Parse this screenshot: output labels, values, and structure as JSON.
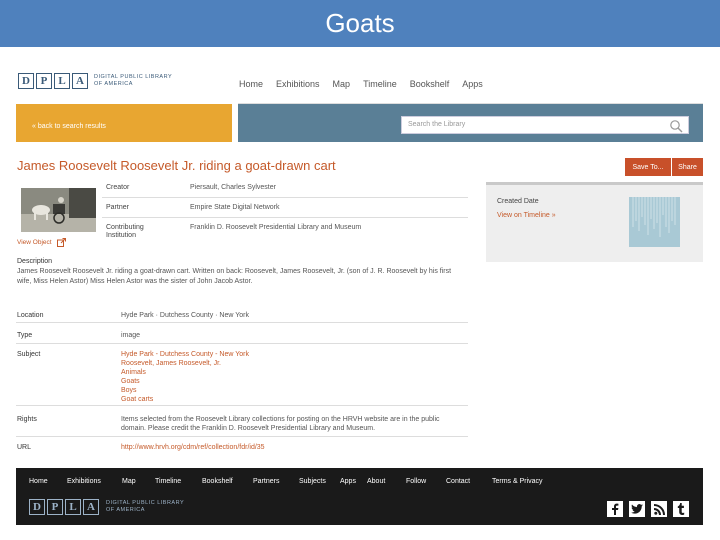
{
  "slide": {
    "title": "Goats"
  },
  "logo": {
    "letters": [
      "D",
      "P",
      "L",
      "A"
    ],
    "line1": "DIGITAL PUBLIC LIBRARY",
    "line2": "OF AMERICA"
  },
  "topnav": [
    "Home",
    "Exhibitions",
    "Map",
    "Timeline",
    "Bookshelf",
    "Apps"
  ],
  "banner": {
    "back_link": "« back to search results",
    "search_placeholder": "Search the Library"
  },
  "item": {
    "title": "James Roosevelt Roosevelt Jr. riding a goat-drawn cart",
    "save_label": "Save To...",
    "share_label": "Share",
    "view_object": "View Object",
    "metadata": [
      {
        "label": "Creator",
        "value": "Piersault, Charles Sylvester"
      },
      {
        "label": "Partner",
        "value": "Empire State Digital Network"
      },
      {
        "label": "Contributing Institution",
        "value": "Franklin D. Roosevelt Presidential Library and Museum"
      }
    ],
    "description_label": "Description",
    "description": "James Roosevelt Roosevelt Jr. riding a goat-drawn cart. Written on back: Roosevelt, James Roosevelt, Jr. (son of J. R. Roosevelt by his first wife, Miss Helen Astor) Miss Helen Astor was the sister of John Jacob Astor.",
    "details": [
      {
        "label": "Location",
        "values": [
          "Hyde Park · Dutchess County · New York"
        ],
        "link": false
      },
      {
        "label": "Type",
        "values": [
          "image"
        ],
        "link": false
      },
      {
        "label": "Subject",
        "values": [
          "Hyde Park - Dutchess County - New York",
          "Roosevelt, James Roosevelt, Jr.",
          "Animals",
          "Goats",
          "Boys",
          "Goat carts"
        ],
        "link": true
      },
      {
        "label": "Rights",
        "values": [
          "Items selected from the Roosevelt Library collections for posting on the HRVH website are in the public",
          "domain. Please credit the Franklin D. Roosevelt Presidential Library and Museum."
        ],
        "link": false
      },
      {
        "label": "URL",
        "values": [
          "http://www.hrvh.org/cdm/ref/collection/fdr/id/35"
        ],
        "link": true
      }
    ]
  },
  "sidebar": {
    "title": "Created Date",
    "link": "View on Timeline »"
  },
  "footer": {
    "nav": [
      "Home",
      "Exhibitions",
      "Map",
      "Timeline",
      "Bookshelf",
      "Partners",
      "Subjects",
      "Apps",
      "About",
      "Follow",
      "Contact",
      "Terms & Privacy"
    ],
    "social_icons": [
      "facebook-icon",
      "twitter-icon",
      "rss-icon",
      "tumblr-icon"
    ]
  },
  "colors": {
    "slide_bar": "#4f81bd",
    "accent_orange": "#e8a631",
    "link_red": "#c55a2a",
    "banner_blue": "#5a7f96",
    "footer_bg": "#1a1a1a"
  }
}
